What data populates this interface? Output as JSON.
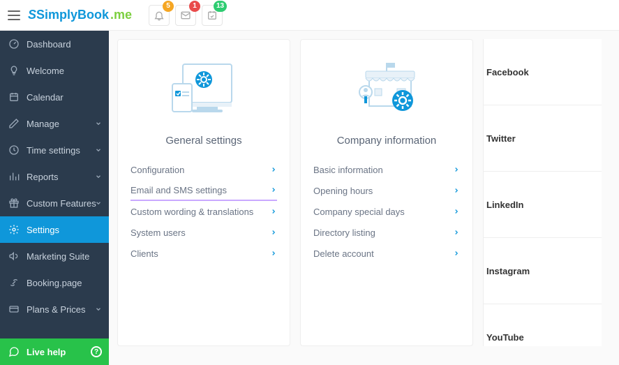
{
  "brand": {
    "name": "SimplyBook",
    "suffix": ".me"
  },
  "topIcons": {
    "bell": {
      "badge": "5",
      "color": "orange"
    },
    "mail": {
      "badge": "1",
      "color": "red"
    },
    "check": {
      "badge": "13",
      "color": "green"
    }
  },
  "sidebar": {
    "items": [
      {
        "label": "Dashboard",
        "icon": "gauge",
        "chev": false
      },
      {
        "label": "Welcome",
        "icon": "bulb",
        "chev": false
      },
      {
        "label": "Calendar",
        "icon": "calendar",
        "chev": false
      },
      {
        "label": "Manage",
        "icon": "pencil",
        "chev": true
      },
      {
        "label": "Time settings",
        "icon": "clock",
        "chev": true
      },
      {
        "label": "Reports",
        "icon": "bars",
        "chev": true
      },
      {
        "label": "Custom Features",
        "icon": "gift",
        "chev": true
      },
      {
        "label": "Settings",
        "icon": "gear",
        "chev": false,
        "active": true
      },
      {
        "label": "Marketing Suite",
        "icon": "megaphone",
        "chev": false
      },
      {
        "label": "Booking.page",
        "icon": "link",
        "chev": false
      },
      {
        "label": "Plans & Prices",
        "icon": "card",
        "chev": true
      }
    ],
    "liveHelp": "Live help"
  },
  "cards": {
    "general": {
      "title": "General settings",
      "items": [
        {
          "label": "Configuration"
        },
        {
          "label": "Email and SMS settings",
          "highlight": true
        },
        {
          "label": "Custom wording & translations"
        },
        {
          "label": "System users"
        },
        {
          "label": "Clients"
        }
      ]
    },
    "company": {
      "title": "Company information",
      "items": [
        {
          "label": "Basic information"
        },
        {
          "label": "Opening hours"
        },
        {
          "label": "Company special days"
        },
        {
          "label": "Directory listing"
        },
        {
          "label": "Delete account"
        }
      ]
    }
  },
  "socials": [
    "Facebook",
    "Twitter",
    "LinkedIn",
    "Instagram",
    "YouTube"
  ]
}
